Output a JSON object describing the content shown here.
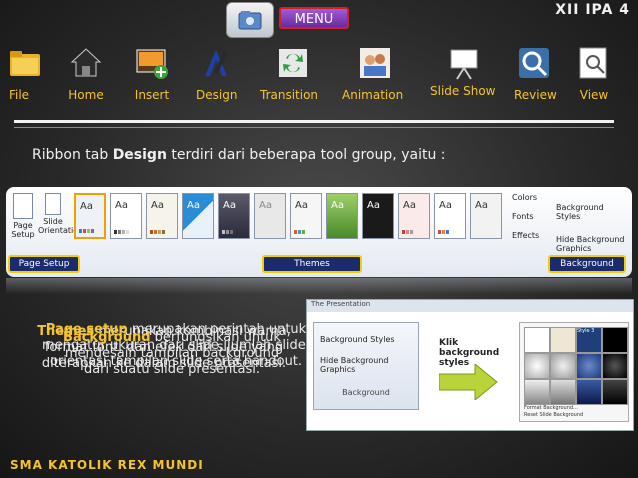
{
  "header": {
    "menu_label": "MENU",
    "class_tag": "XII IPA 4"
  },
  "nav": [
    {
      "label": "File",
      "icon": "folder-icon"
    },
    {
      "label": "Home",
      "icon": "home-icon"
    },
    {
      "label": "Insert",
      "icon": "insert-image-icon"
    },
    {
      "label": "Design",
      "icon": "design-icon"
    },
    {
      "label": "Transition",
      "icon": "transition-icon"
    },
    {
      "label": "Animation",
      "icon": "animation-icon"
    },
    {
      "label": "Slide Show",
      "icon": "projector-icon"
    },
    {
      "label": "Review",
      "icon": "review-icon"
    },
    {
      "label": "View",
      "icon": "view-icon"
    }
  ],
  "intro": {
    "prefix": "Ribbon tab ",
    "bold": "Design",
    "suffix": " terdiri dari beberapa tool group, yaitu :"
  },
  "ribbon": {
    "page_setup_label": "Page Setup",
    "slide_orientation_label": "Slide Orientation",
    "theme_sample_text": "Aa",
    "colors_label": "Colors",
    "fonts_label": "Fonts",
    "effects_label": "Effects",
    "bg_styles_label": "Background Styles",
    "hide_bg_label": "Hide Background Graphics",
    "groups": {
      "page_setup": "Page Setup",
      "themes": "Themes",
      "background": "Background"
    }
  },
  "overlay_texts": {
    "title_page_setup": "Page setup",
    "text_page_setup": "merupakan perintah untuk mengatur ukuran dari slide, jumlah slide, orientasi tampilan slide serta handout.",
    "title_themes": "Themes",
    "text_themes": "merupakan kombinasi warna, format font, dan efek dari slide yang diterapkan ke dalam slide presentasi.",
    "title_background": "Background",
    "text_background": "berfungsikan untuk mendesain tampilan background dari suatu slide presentasi."
  },
  "bg_panel": {
    "title_bar": "The Presentation",
    "bg_styles": "Background Styles",
    "hide_bg": "Hide Background Graphics",
    "group_name": "Background",
    "callout": "Klik background styles",
    "format_background": "Format Background...",
    "reset_background": "Reset Slide Background",
    "style_tip": "Style 3"
  },
  "footer": "SMA KATOLIK REX MUNDI",
  "colors": {
    "accent_yellow": "#f4c430",
    "group_label_bg": "#1c2a6e",
    "group_label_border": "#f0d000",
    "menu_purple": "#8a3fbf"
  }
}
